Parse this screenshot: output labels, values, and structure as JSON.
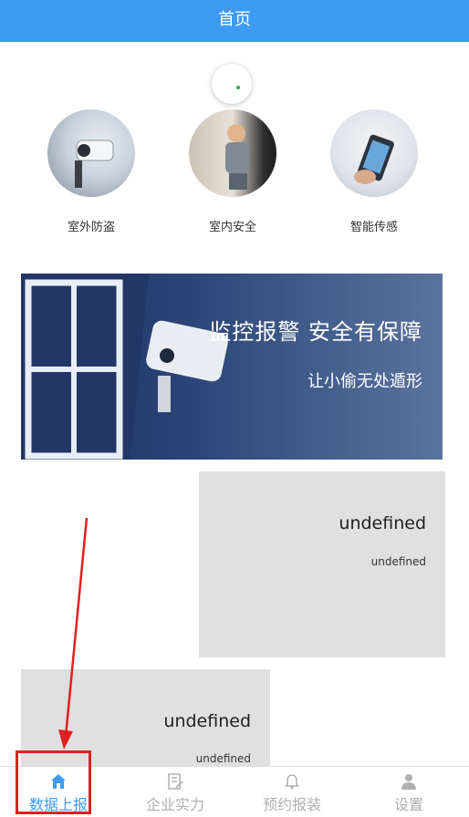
{
  "header": {
    "title": "首页"
  },
  "categories": [
    {
      "label": "室外防盗",
      "icon": "outdoor-camera-photo"
    },
    {
      "label": "室内安全",
      "icon": "child-at-door-photo"
    },
    {
      "label": "智能传感",
      "icon": "smartphone-sensor-photo"
    }
  ],
  "banner": {
    "title": "监控报警 安全有保障",
    "subtitle": "让小偷无处遁形"
  },
  "cards": [
    {
      "title": "undefined",
      "subtitle": "undefined"
    },
    {
      "title": "undefined",
      "subtitle": "undefined"
    }
  ],
  "tabbar": {
    "items": [
      {
        "label": "数据上报",
        "icon": "home-icon",
        "active": true
      },
      {
        "label": "企业实力",
        "icon": "edit-doc-icon",
        "active": false
      },
      {
        "label": "预约报装",
        "icon": "bell-icon",
        "active": false
      },
      {
        "label": "设置",
        "icon": "user-icon",
        "active": false
      }
    ]
  },
  "colors": {
    "primary": "#3d9bf3",
    "card_bg": "#e0e0e0",
    "annotation": "#e02020",
    "inactive_tab": "#b0b0b0"
  }
}
